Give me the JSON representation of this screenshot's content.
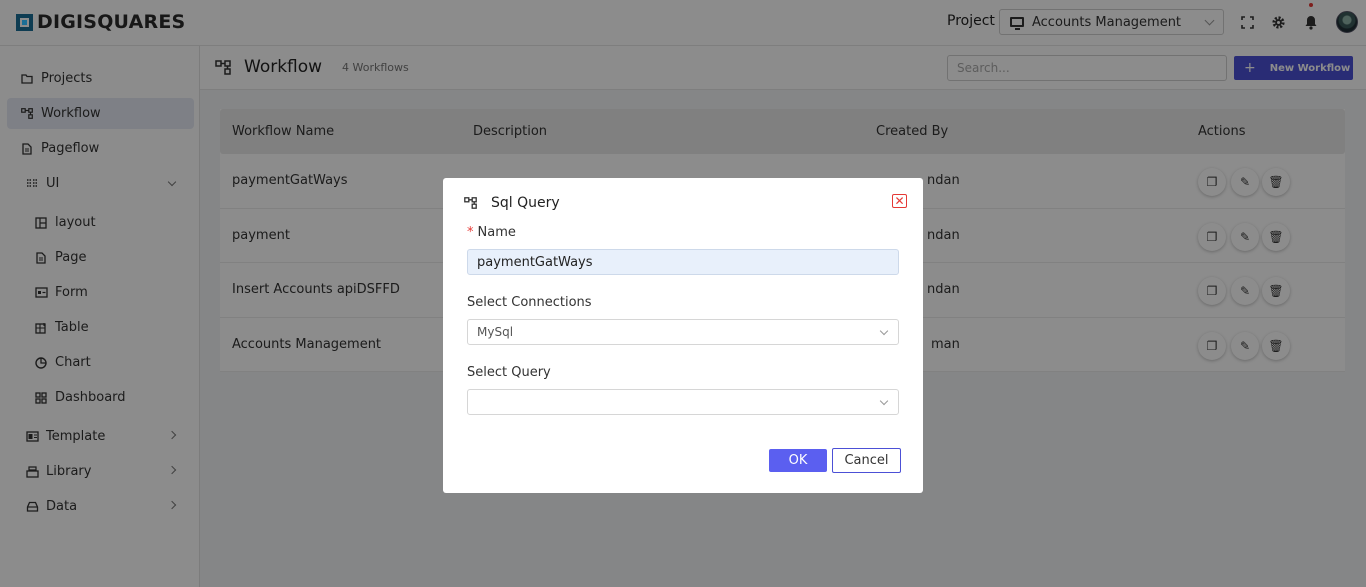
{
  "header": {
    "logo_text": "DIGISQUARES",
    "project_label": "Project",
    "project_value": "Accounts Management"
  },
  "sidebar": {
    "items": [
      {
        "label": "Projects",
        "icon": "folder-icon"
      },
      {
        "label": "Workflow",
        "icon": "workflow-icon"
      },
      {
        "label": "Pageflow",
        "icon": "file-icon"
      },
      {
        "label": "UI",
        "icon": "ui-icon"
      },
      {
        "label": "layout",
        "icon": "layout-icon"
      },
      {
        "label": "Page",
        "icon": "page-icon"
      },
      {
        "label": "Form",
        "icon": "form-icon"
      },
      {
        "label": "Table",
        "icon": "table-icon"
      },
      {
        "label": "Chart",
        "icon": "chart-icon"
      },
      {
        "label": "Dashboard",
        "icon": "dashboard-icon"
      },
      {
        "label": "Template",
        "icon": "template-icon"
      },
      {
        "label": "Library",
        "icon": "library-icon"
      },
      {
        "label": "Data",
        "icon": "data-icon"
      }
    ]
  },
  "page": {
    "title": "Workflow",
    "count": "4 Workflows",
    "search_placeholder": "Search...",
    "new_button": "New Workflow"
  },
  "table": {
    "columns": [
      "Workflow Name",
      "Description",
      "Created By",
      "Actions"
    ],
    "rows": [
      {
        "name": "paymentGatWays",
        "created_by": "ndan"
      },
      {
        "name": "payment",
        "created_by": "ndan"
      },
      {
        "name": "Insert Accounts apiDSFFD",
        "created_by": "ndan"
      },
      {
        "name": "Accounts Management",
        "created_by": "man"
      }
    ]
  },
  "modal": {
    "title": "Sql Query",
    "name_label": "Name",
    "name_value": "paymentGatWays",
    "connections_label": "Select Connections",
    "connections_value": "MySql",
    "query_label": "Select Query",
    "query_value": "",
    "ok_label": "OK",
    "cancel_label": "Cancel"
  },
  "colors": {
    "accent": "#4c50d6",
    "close": "#e53935"
  }
}
